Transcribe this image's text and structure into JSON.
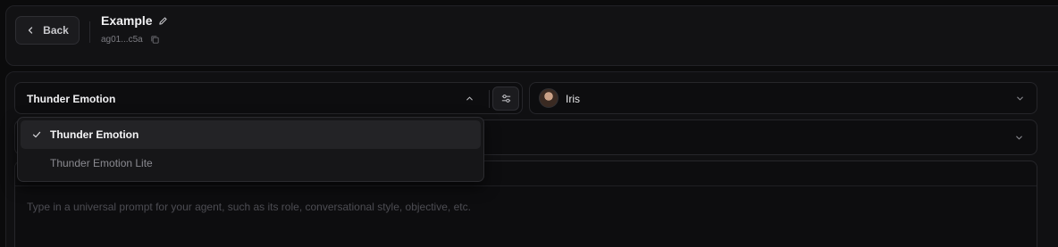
{
  "header": {
    "back_label": "Back",
    "title": "Example",
    "agent_id": "ag01...c5a"
  },
  "model_select": {
    "selected": "Thunder Emotion",
    "options": [
      "Thunder Emotion",
      "Thunder Emotion Lite"
    ]
  },
  "voice_select": {
    "selected": "Iris"
  },
  "prompt": {
    "placeholder": "Type in a universal prompt for your agent, such as its role, conversational style, objective, etc.",
    "value": ""
  }
}
